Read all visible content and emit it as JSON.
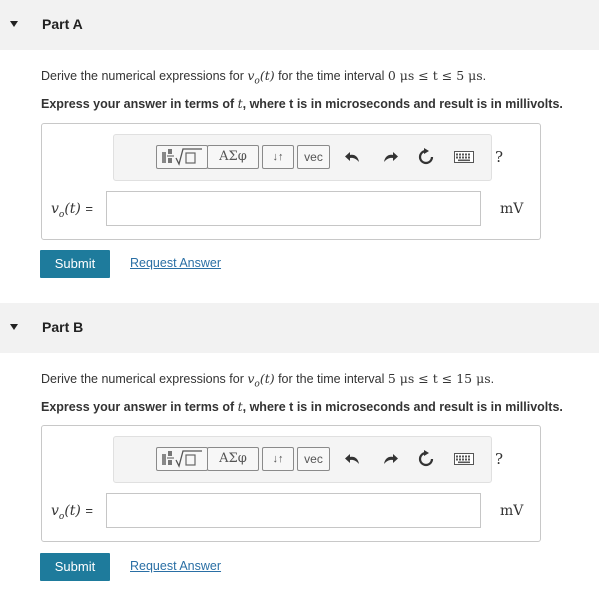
{
  "parts": [
    {
      "title": "Part A",
      "question_prefix": "Derive the numerical expressions for ",
      "question_var": "v",
      "question_sub": "o",
      "question_arg": "(t)",
      "question_mid": " for the time interval ",
      "interval": "0 μs ≤ t ≤ 5 μs",
      "question_end": ".",
      "instruction_a": "Express your answer in terms of ",
      "instruction_t": "t",
      "instruction_b": ", where t is in microseconds and result is in millivolts.",
      "label": "vo(t) =",
      "unit": "mV",
      "input_value": "",
      "submit_label": "Submit",
      "request_label": "Request Answer"
    },
    {
      "title": "Part B",
      "question_prefix": "Derive the numerical expressions for ",
      "question_var": "v",
      "question_sub": "o",
      "question_arg": "(t)",
      "question_mid": " for the time interval ",
      "interval": "5 μs ≤ t ≤ 15 μs",
      "question_end": ".",
      "instruction_a": "Express your answer in terms of ",
      "instruction_t": "t",
      "instruction_b": ", where t is in microseconds and result is in millivolts.",
      "label": "vo(t) =",
      "unit": "mV",
      "input_value": "",
      "submit_label": "Submit",
      "request_label": "Request Answer"
    }
  ],
  "toolbar": {
    "templates_icon": "fraction-sqrt-template-icon",
    "greek_label": "ΑΣφ",
    "arrows_label": "↓↑",
    "vec_label": "vec",
    "undo_icon": "undo-icon",
    "redo_icon": "redo-icon",
    "reset_icon": "reset-icon",
    "keyboard_icon": "keyboard-icon",
    "help_label": "?"
  }
}
